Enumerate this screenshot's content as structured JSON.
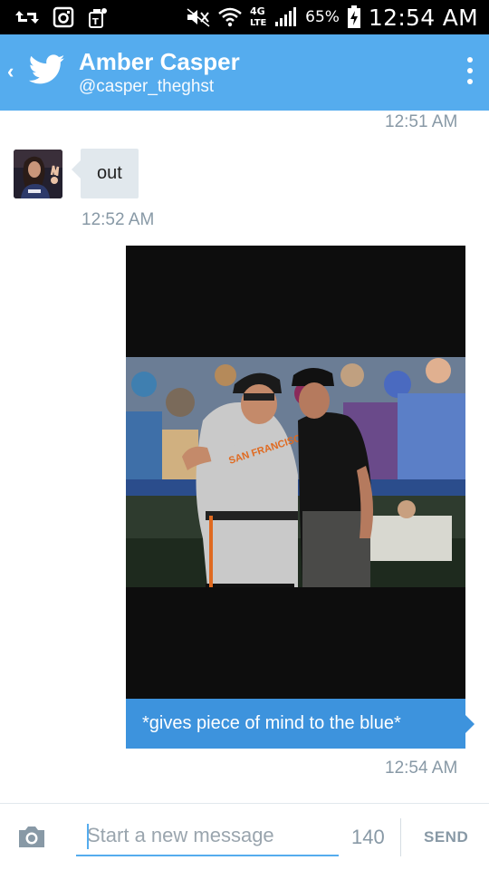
{
  "status_bar": {
    "battery_pct": "65%",
    "time": "12:54 AM",
    "network": "4G LTE",
    "icons": [
      "retweet-icon",
      "instagram-icon",
      "tmobile-icon",
      "mute-icon",
      "wifi-icon",
      "lte-icon",
      "signal-icon",
      "battery-charging-icon"
    ]
  },
  "header": {
    "title": "Amber Casper",
    "handle": "@casper_theghst"
  },
  "messages": {
    "ts_prev": "12:51 AM",
    "incoming_text": "out",
    "ts_incoming": "12:52 AM",
    "outgoing_caption": "*gives piece of mind to the blue*",
    "ts_outgoing": "12:54 AM",
    "photo_jersey_text": "SAN FRANCISCO"
  },
  "compose": {
    "placeholder": "Start a new message",
    "char_count": "140",
    "send_label": "SEND"
  },
  "colors": {
    "twitter_blue": "#55acee",
    "outgoing_bubble": "#3d93dd",
    "incoming_bubble": "#e1e8ed",
    "muted_text": "#8899a6"
  }
}
